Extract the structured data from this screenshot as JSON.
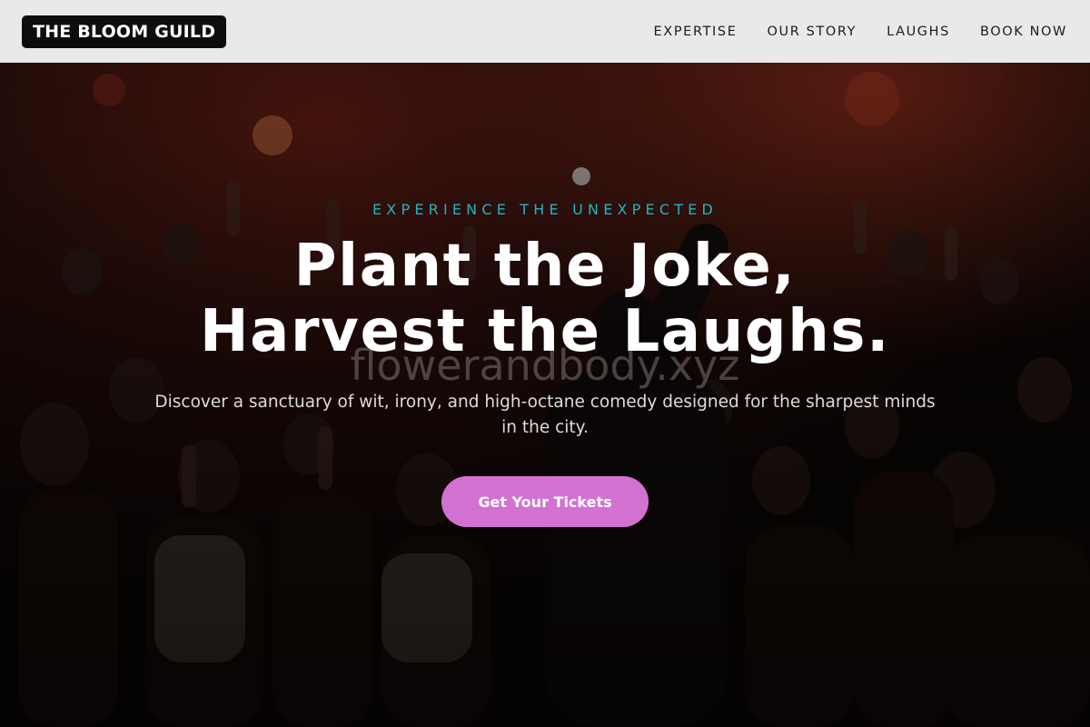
{
  "header": {
    "logo": "THE BLOOM GUILD",
    "nav": [
      {
        "label": "EXPERTISE"
      },
      {
        "label": "OUR STORY"
      },
      {
        "label": "LAUGHS"
      },
      {
        "label": "BOOK NOW"
      }
    ]
  },
  "hero": {
    "eyebrow": "EXPERIENCE THE UNEXPECTED",
    "title_line1": "Plant the Joke,",
    "title_line2": "Harvest the Laughs.",
    "watermark": "flowerandbody.xyz",
    "subtitle": "Discover a sanctuary of wit, irony, and high-octane comedy designed for the sharpest minds in the city.",
    "cta_label": "Get Your Tickets",
    "background_image": "crowd-at-comedy-show-photo"
  },
  "colors": {
    "accent_teal": "#1fb5c4",
    "cta_pink": "#d371d3",
    "header_bg": "#e9e9e9",
    "logo_bg": "#0d0d0d"
  }
}
